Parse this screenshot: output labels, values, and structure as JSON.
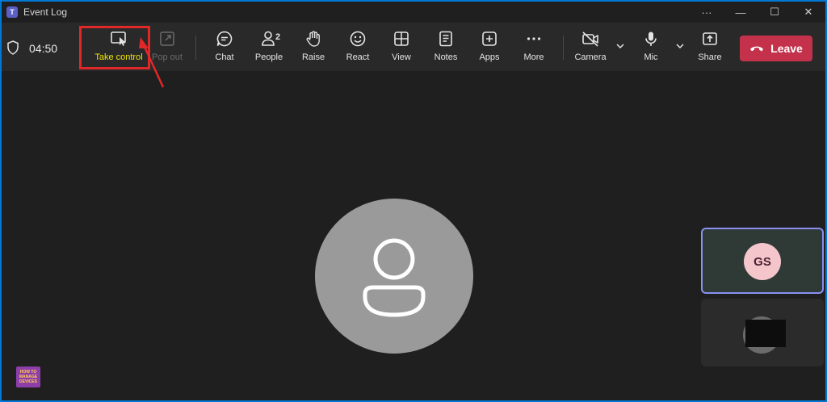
{
  "window": {
    "title": "Event Log",
    "app_icon_letter": "T"
  },
  "window_controls": {
    "more": "···",
    "minimize": "—",
    "maximize": "☐",
    "close": "✕"
  },
  "meeting": {
    "timer": "04:50"
  },
  "toolbar": {
    "take_control": "Take control",
    "pop_out": "Pop out",
    "chat": "Chat",
    "people": "People",
    "people_count": "2",
    "raise": "Raise",
    "react": "React",
    "view": "View",
    "notes": "Notes",
    "apps": "Apps",
    "more": "More",
    "camera": "Camera",
    "mic": "Mic",
    "share": "Share",
    "leave": "Leave"
  },
  "participants": [
    {
      "initials": "GS"
    }
  ],
  "colors": {
    "leave": "#c4314b",
    "highlight": "#e02828",
    "active_tile_border": "#8a8ff0",
    "take_control_label": "#f2e600"
  },
  "icons": [
    "shield-icon",
    "take-control-icon",
    "pop-out-icon",
    "chat-icon",
    "people-icon",
    "raise-hand-icon",
    "react-icon",
    "view-icon",
    "notes-icon",
    "apps-icon",
    "more-icon",
    "camera-off-icon",
    "mic-icon",
    "share-icon",
    "phone-hangup-icon"
  ]
}
